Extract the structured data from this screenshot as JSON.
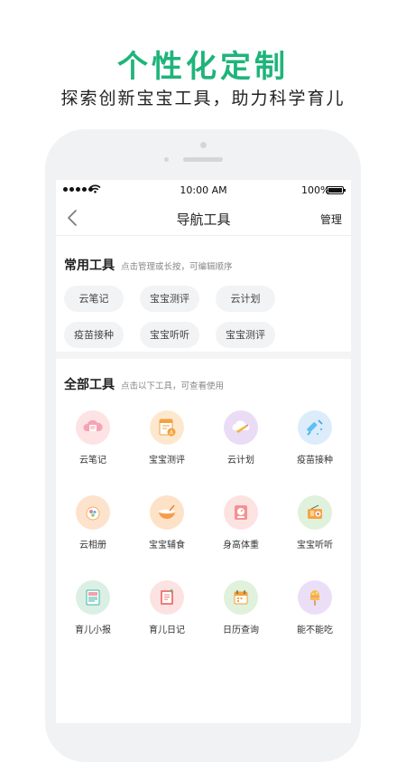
{
  "promo": {
    "title": "个性化定制",
    "subtitle": "探索创新宝宝工具，助力科学育儿"
  },
  "status_bar": {
    "time": "10:00 AM",
    "battery": "100%"
  },
  "navbar": {
    "title": "导航工具",
    "action": "管理"
  },
  "common_tools": {
    "title": "常用工具",
    "hint": "点击管理或长按，可编辑顺序",
    "items": [
      "云笔记",
      "宝宝测评",
      "云计划",
      "疫苗接种",
      "宝宝听听",
      "宝宝测评"
    ]
  },
  "all_tools": {
    "title": "全部工具",
    "hint": "点击以下工具，可查看使用",
    "items": [
      {
        "label": "云笔记",
        "icon": "cloud-note-icon",
        "color": "#fde3e3"
      },
      {
        "label": "宝宝测评",
        "icon": "evaluation-icon",
        "color": "#fde8cf"
      },
      {
        "label": "云计划",
        "icon": "cloud-plan-icon",
        "color": "#ebdcf6"
      },
      {
        "label": "疫苗接种",
        "icon": "vaccine-icon",
        "color": "#dcecfb"
      },
      {
        "label": "云相册",
        "icon": "cloud-album-icon",
        "color": "#fde3cd"
      },
      {
        "label": "宝宝辅食",
        "icon": "baby-food-icon",
        "color": "#fde2c8"
      },
      {
        "label": "身高体重",
        "icon": "height-weight-icon",
        "color": "#fde2e2"
      },
      {
        "label": "宝宝听听",
        "icon": "radio-icon",
        "color": "#e0f1dc"
      },
      {
        "label": "育儿小报",
        "icon": "newspaper-icon",
        "color": "#dcefe5"
      },
      {
        "label": "育儿日记",
        "icon": "diary-icon",
        "color": "#fde2e2"
      },
      {
        "label": "日历查询",
        "icon": "calendar-icon",
        "color": "#e0f1dc"
      },
      {
        "label": "能不能吃",
        "icon": "ice-cream-icon",
        "color": "#ebdff8"
      }
    ]
  },
  "colors": {
    "accent": "#1fb47a"
  }
}
